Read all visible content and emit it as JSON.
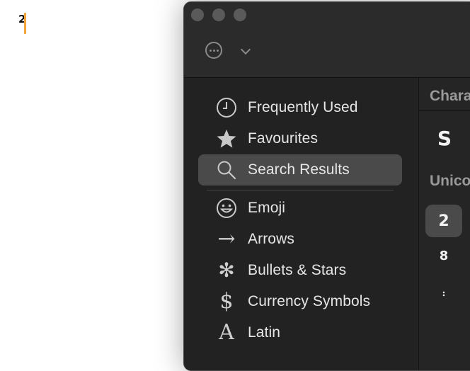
{
  "document": {
    "text": "2"
  },
  "sidebar": {
    "items": [
      {
        "label": "Frequently Used",
        "icon": "clock-icon"
      },
      {
        "label": "Favourites",
        "icon": "star-icon"
      },
      {
        "label": "Search Results",
        "icon": "magnifying-glass-icon",
        "selected": true
      },
      {
        "label": "Emoji",
        "icon": "smiley-face-icon"
      },
      {
        "label": "Arrows",
        "icon": "right-arrow-icon",
        "glyph": "→"
      },
      {
        "label": "Bullets & Stars",
        "icon": "asterisk-icon",
        "glyph": "✻"
      },
      {
        "label": "Currency Symbols",
        "icon": "dollar-sign-icon",
        "glyph": "$"
      },
      {
        "label": "Latin",
        "icon": "letter-a-icon",
        "glyph": "A"
      }
    ]
  },
  "content": {
    "header_title": "Chara",
    "characters_row": [
      "S"
    ],
    "unicode_title": "Unico",
    "unicode_chars": [
      "2",
      "8",
      "܄"
    ]
  },
  "colors": {
    "accent_caret": "#f2a33a",
    "selection": "#4a4a4a"
  }
}
